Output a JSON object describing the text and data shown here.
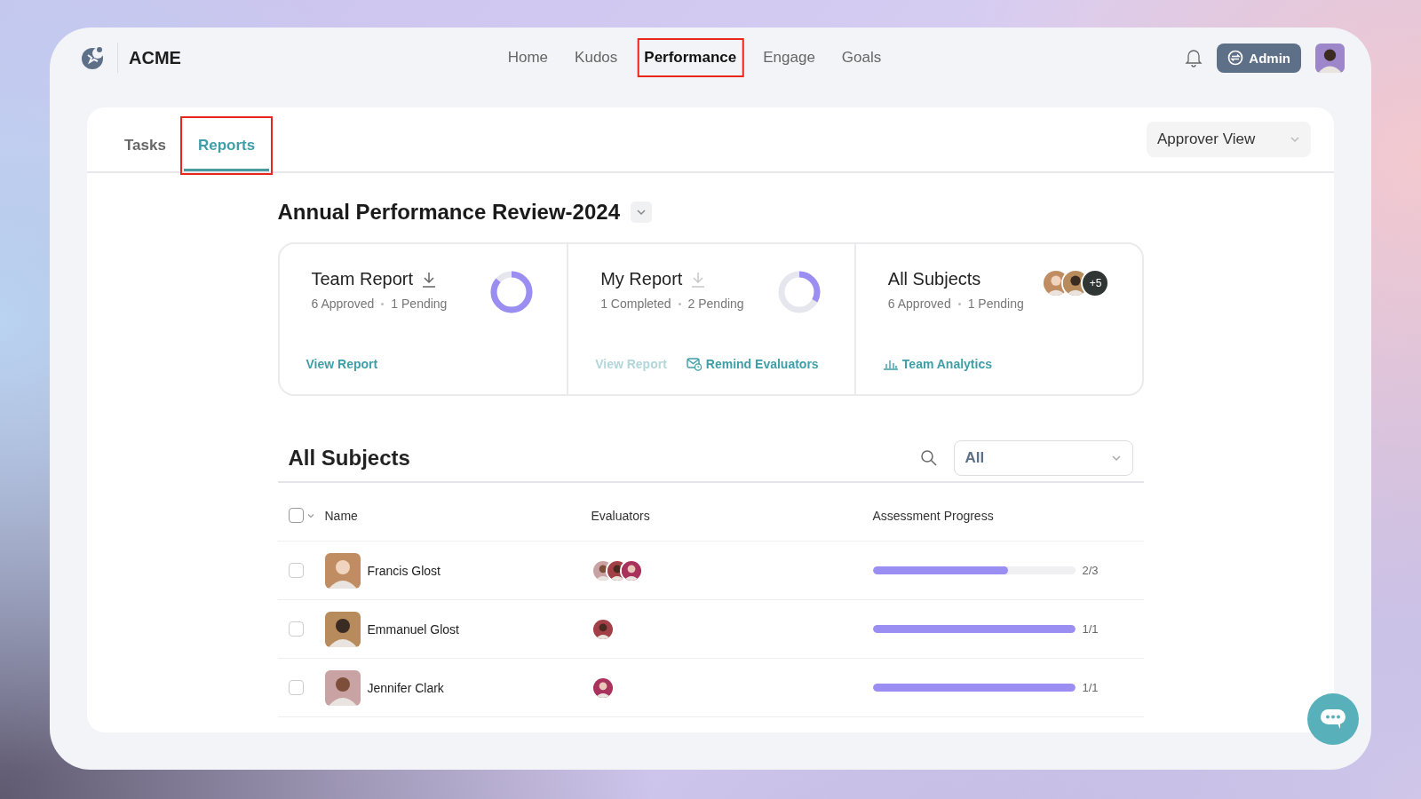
{
  "brand": {
    "name": "ACME"
  },
  "nav": [
    {
      "label": "Home",
      "selected": false,
      "highlighted": false
    },
    {
      "label": "Kudos",
      "selected": false,
      "highlighted": false
    },
    {
      "label": "Performance",
      "selected": true,
      "highlighted": true
    },
    {
      "label": "Engage",
      "selected": false,
      "highlighted": false
    },
    {
      "label": "Goals",
      "selected": false,
      "highlighted": false
    }
  ],
  "header": {
    "admin_button": "Admin"
  },
  "tabs": [
    {
      "label": "Tasks",
      "selected": false,
      "highlighted": false
    },
    {
      "label": "Reports",
      "selected": true,
      "highlighted": true
    }
  ],
  "view_select": {
    "value": "Approver View"
  },
  "review": {
    "title": "Annual Performance Review-2024"
  },
  "summary_cards": [
    {
      "kind": "report",
      "title": "Team Report",
      "download_disabled": false,
      "stats": [
        "6 Approved",
        "1 Pending"
      ],
      "links": [
        {
          "label": "View Report",
          "kind": "plain",
          "disabled": false
        }
      ]
    },
    {
      "kind": "report",
      "title": "My Report",
      "download_disabled": true,
      "stats": [
        "1 Completed",
        "2 Pending"
      ],
      "links": [
        {
          "label": "View Report",
          "kind": "plain",
          "disabled": true
        },
        {
          "label": "Remind Evaluators",
          "kind": "remind",
          "disabled": false
        }
      ]
    },
    {
      "kind": "subjects",
      "title": "All Subjects",
      "stats": [
        "6 Approved",
        "1 Pending"
      ],
      "avatars": [
        {
          "kind": "picture"
        },
        {
          "kind": "picture"
        },
        {
          "kind": "count",
          "label": "+5"
        }
      ],
      "links": [
        {
          "label": "Team Analytics",
          "kind": "analytics",
          "disabled": false
        }
      ]
    }
  ],
  "subjects": {
    "title": "All Subjects",
    "filter": {
      "value": "All"
    },
    "select_all": {
      "checked": false
    },
    "columns": [
      "Name",
      "Evaluators",
      "Assessment Progress"
    ],
    "rows": [
      {
        "name": "Francis Glost",
        "checked": false,
        "evaluators": [
          {
            "kind": "picture"
          },
          {
            "kind": "picture"
          },
          {
            "kind": "picture"
          }
        ],
        "level": 0.67,
        "progress": "2/3"
      },
      {
        "name": "Emmanuel Glost",
        "checked": false,
        "evaluators": [
          {
            "kind": "picture"
          }
        ],
        "level": 1,
        "progress": "1/1"
      },
      {
        "name": "Jennifer Clark",
        "checked": false,
        "evaluators": [
          {
            "kind": "picture"
          }
        ],
        "level": 1,
        "progress": "1/1"
      }
    ]
  }
}
